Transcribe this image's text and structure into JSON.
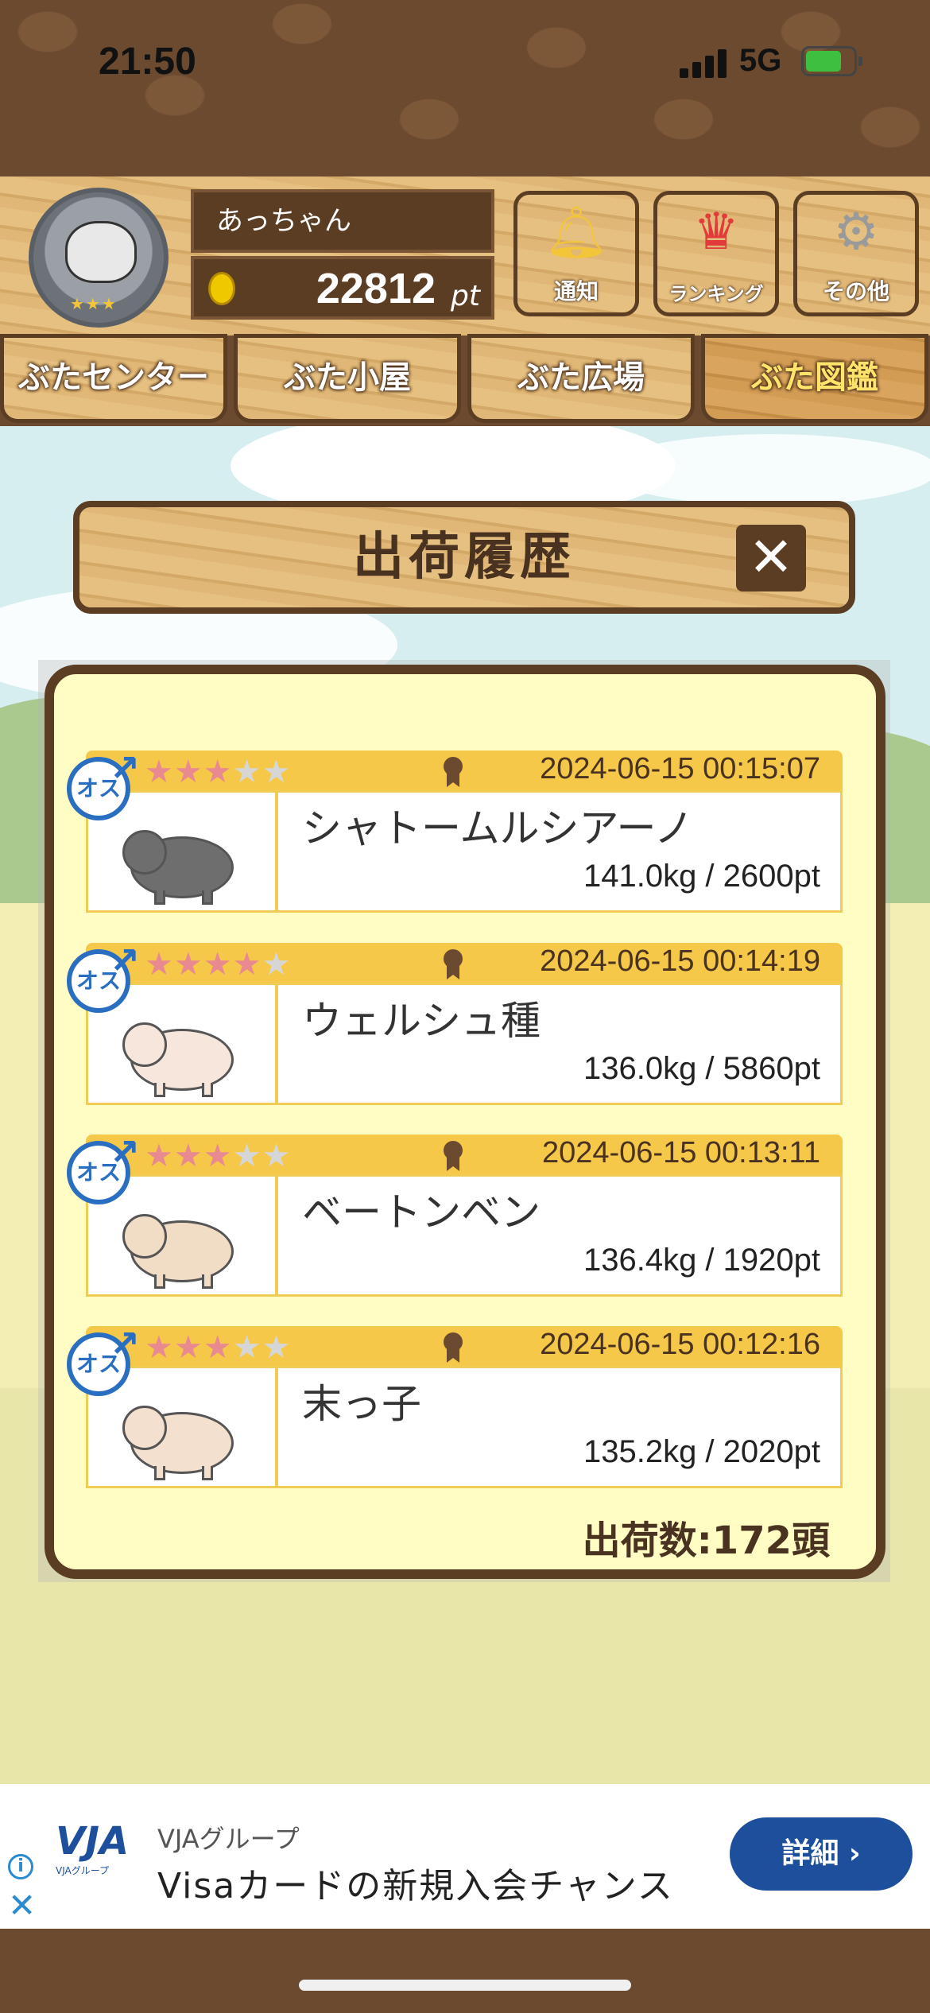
{
  "status_bar": {
    "time": "21:50",
    "network": "5G"
  },
  "header": {
    "user_name": "あっちゃん",
    "points": "22812",
    "points_unit": "pt",
    "buttons": [
      {
        "label": "通知",
        "icon": "bell-icon"
      },
      {
        "label": "ランキング",
        "icon": "crown-icon"
      },
      {
        "label": "その他",
        "icon": "gear-icon"
      }
    ]
  },
  "tabs": [
    {
      "label": "ぶたセンター",
      "active": false
    },
    {
      "label": "ぶた小屋",
      "active": false
    },
    {
      "label": "ぶた広場",
      "active": false
    },
    {
      "label": "ぶた図鑑",
      "active": true
    }
  ],
  "modal": {
    "title": "出荷履歴",
    "close_label": "✕",
    "entries": [
      {
        "sex": "オス",
        "stars": 3,
        "max_stars": 5,
        "datetime": "2024-06-15 00:15:07",
        "name": "シャトームルシアーノ",
        "weight_points": "141.0kg / 2600pt",
        "pig_color": "#6e6e6e"
      },
      {
        "sex": "オス",
        "stars": 4,
        "max_stars": 5,
        "datetime": "2024-06-15 00:14:19",
        "name": "ウェルシュ種",
        "weight_points": "136.0kg / 5860pt",
        "pig_color": "#f7e6dc"
      },
      {
        "sex": "オス",
        "stars": 3,
        "max_stars": 5,
        "datetime": "2024-06-15 00:13:11",
        "name": "ベートンベン",
        "weight_points": "136.4kg / 1920pt",
        "pig_color": "#f1dcc6"
      },
      {
        "sex": "オス",
        "stars": 3,
        "max_stars": 5,
        "datetime": "2024-06-15 00:12:16",
        "name": "末っ子",
        "weight_points": "135.2kg / 2020pt",
        "pig_color": "#f3e0cf"
      }
    ],
    "shipment_count": "出荷数:172頭"
  },
  "ad": {
    "logo_text": "VJA",
    "logo_sub": "VJAグループ",
    "org": "VJAグループ",
    "title": "Visaカードの新規入会チャンス",
    "cta": "詳細 ›"
  },
  "colors": {
    "brown": "#5b3d24",
    "gold": "#f5c84a",
    "cream": "#fffcc4",
    "male_blue": "#2a6ec2",
    "ad_blue": "#1d4f9c"
  }
}
